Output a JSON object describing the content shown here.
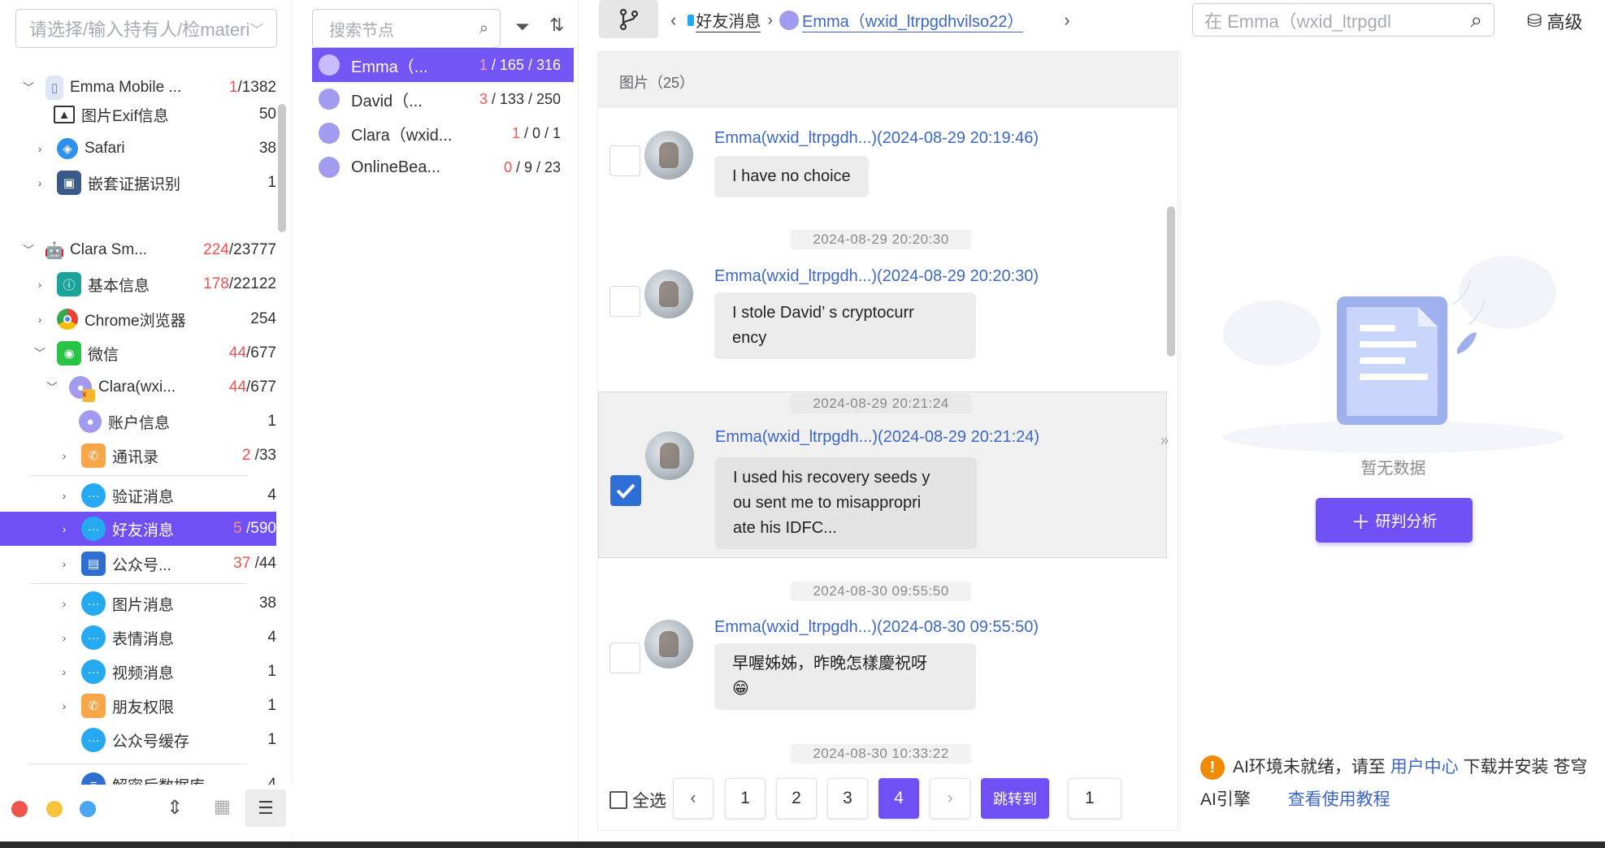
{
  "left": {
    "holder_placeholder": "请选择/输入持有人/检material",
    "tree": [
      {
        "label": "Emma  Mobile ...",
        "red": "1",
        "count": "/1382"
      },
      {
        "label": "图片Exif信息",
        "red": "",
        "count": "50"
      },
      {
        "label": "Safari",
        "red": "",
        "count": "38"
      },
      {
        "label": "嵌套证据识别",
        "red": "",
        "count": "1"
      },
      {
        "label": "Clara  Sm...",
        "red": "224",
        "count": "/23777"
      },
      {
        "label": "基本信息",
        "red": "178",
        "count": "/22122"
      },
      {
        "label": "Chrome浏览器",
        "red": "",
        "count": "254"
      },
      {
        "label": "微信",
        "red": "44",
        "count": "/677"
      },
      {
        "label": "Clara(wxi...",
        "red": "44",
        "count": "/677"
      },
      {
        "label": "账户信息",
        "red": "",
        "count": "1"
      },
      {
        "label": "通讯录",
        "red": "2",
        "count": "/33"
      },
      {
        "label": "验证消息",
        "red": "",
        "count": "4"
      },
      {
        "label": "好友消息",
        "red": "5",
        "count": "/590"
      },
      {
        "label": "公众号...",
        "red": "37",
        "count": "/44"
      },
      {
        "label": "图片消息",
        "red": "",
        "count": "38"
      },
      {
        "label": "表情消息",
        "red": "",
        "count": "4"
      },
      {
        "label": "视频消息",
        "red": "",
        "count": "1"
      },
      {
        "label": "朋友权限",
        "red": "",
        "count": "1"
      },
      {
        "label": "公众号缓存",
        "red": "",
        "count": "1"
      },
      {
        "label": "解密后数据库",
        "red": "",
        "count": "4"
      }
    ]
  },
  "nodes": {
    "search_placeholder": "搜索节点",
    "items": [
      {
        "name": "Emma（...",
        "red": "1",
        "rest": " / 165 / 316"
      },
      {
        "name": "David（...",
        "red": "3",
        "rest": " / 133 / 250"
      },
      {
        "name": "Clara（wxid...",
        "red": "1",
        "rest": " / 0 / 1"
      },
      {
        "name": "OnlineBea...",
        "red": "0",
        "rest": " / 9 / 23"
      }
    ]
  },
  "topbar": {
    "crumb1": "好友消息",
    "crumb2": "Emma（wxid_ltrpgdhvilso22）",
    "search_placeholder": "在 Emma（wxid_ltrpgdl",
    "advanced": "高级"
  },
  "chat": {
    "header": "图片（25）",
    "messages": [
      {
        "sender": "Emma(wxid_ltrpgdh...)(2024-08-29 20:19:46)",
        "text": "I have no choice"
      },
      {
        "stamp": "2024-08-29 20:20:30",
        "sender": "Emma(wxid_ltrpgdh...)(2024-08-29 20:20:30)",
        "line1": "I stole David’ s cryptocurr",
        "line2": "ency"
      },
      {
        "stamp": "2024-08-29 20:21:24",
        "sender": "Emma(wxid_ltrpgdh...)(2024-08-29 20:21:24)",
        "line1": "I used his recovery seeds y",
        "line2": "ou sent me to misappropri",
        "line3": "ate his IDFC..."
      },
      {
        "stamp": "2024-08-30 09:55:50",
        "sender": "Emma(wxid_ltrpgdh...)(2024-08-30 09:55:50)",
        "line1": "早喔姊姊，昨晚怎樣慶祝呀",
        "line2": "😁"
      },
      {
        "stamp": "2024-08-30 10:33:22"
      }
    ],
    "pager": {
      "select_all": "全选",
      "pages": [
        "1",
        "2",
        "3",
        "4"
      ],
      "jump_label": "跳转到",
      "jump_value": "1"
    }
  },
  "right": {
    "empty_text": "暂无数据",
    "analyze_label": "研判分析",
    "ai_note_prefix": "AI环境未就绪，请至 ",
    "ai_note_link": "用户中心",
    "ai_note_middle": " 下载并安装 苍穹AI引擎",
    "ai_note_tutorial": "查看使用教程"
  },
  "colors": {
    "accent": "#6e50f5",
    "link": "#3d67c6",
    "warn": "#f08b00",
    "red": "#f35050"
  }
}
